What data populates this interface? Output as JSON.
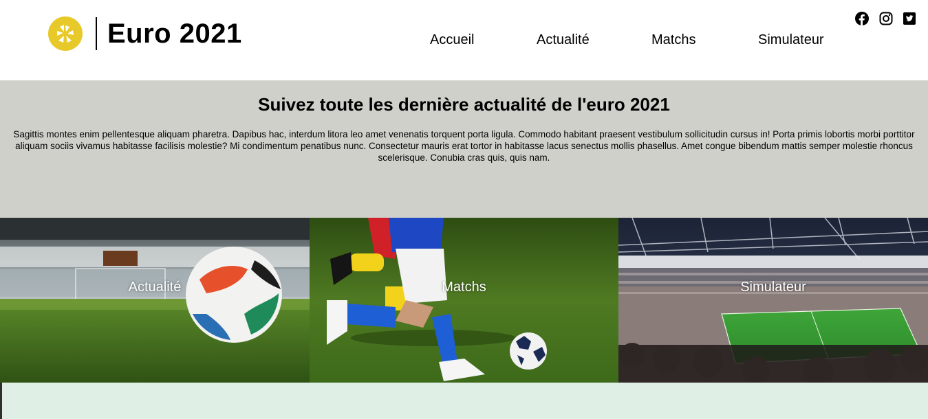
{
  "header": {
    "logo_text": "Euro 2021",
    "logo_icon": "camera-aperture-icon",
    "logo_color": "#e8c92a"
  },
  "nav": {
    "items": [
      {
        "label": "Accueil"
      },
      {
        "label": "Actualité"
      },
      {
        "label": "Matchs"
      },
      {
        "label": "Simulateur"
      }
    ]
  },
  "social": [
    "facebook-icon",
    "instagram-icon",
    "twitter-icon"
  ],
  "intro": {
    "title": "Suivez toute les dernière actualité de l'euro 2021",
    "text": "Sagittis montes enim pellentesque aliquam pharetra. Dapibus hac, interdum litora leo amet venenatis torquent porta ligula. Commodo habitant praesent vestibulum sollicitudin cursus in! Porta primis lobortis morbi porttitor aliquam sociis vivamus habitasse facilisis molestie? Mi condimentum penatibus nunc. Consectetur mauris erat tortor in habitasse lacus senectus mollis phasellus. Amet congue bibendum mattis semper molestie rhoncus scelerisque. Conubia cras quis, quis nam."
  },
  "cards": [
    {
      "label": "Actualité",
      "image": "football-on-grass-photo"
    },
    {
      "label": "Matchs",
      "image": "players-kicking-ball-photo"
    },
    {
      "label": "Simulateur",
      "image": "stadium-crowd-photo"
    }
  ],
  "colors": {
    "intro_bg": "#d0d0cb",
    "footer_bg": "#e0efe6",
    "text": "#000000"
  }
}
